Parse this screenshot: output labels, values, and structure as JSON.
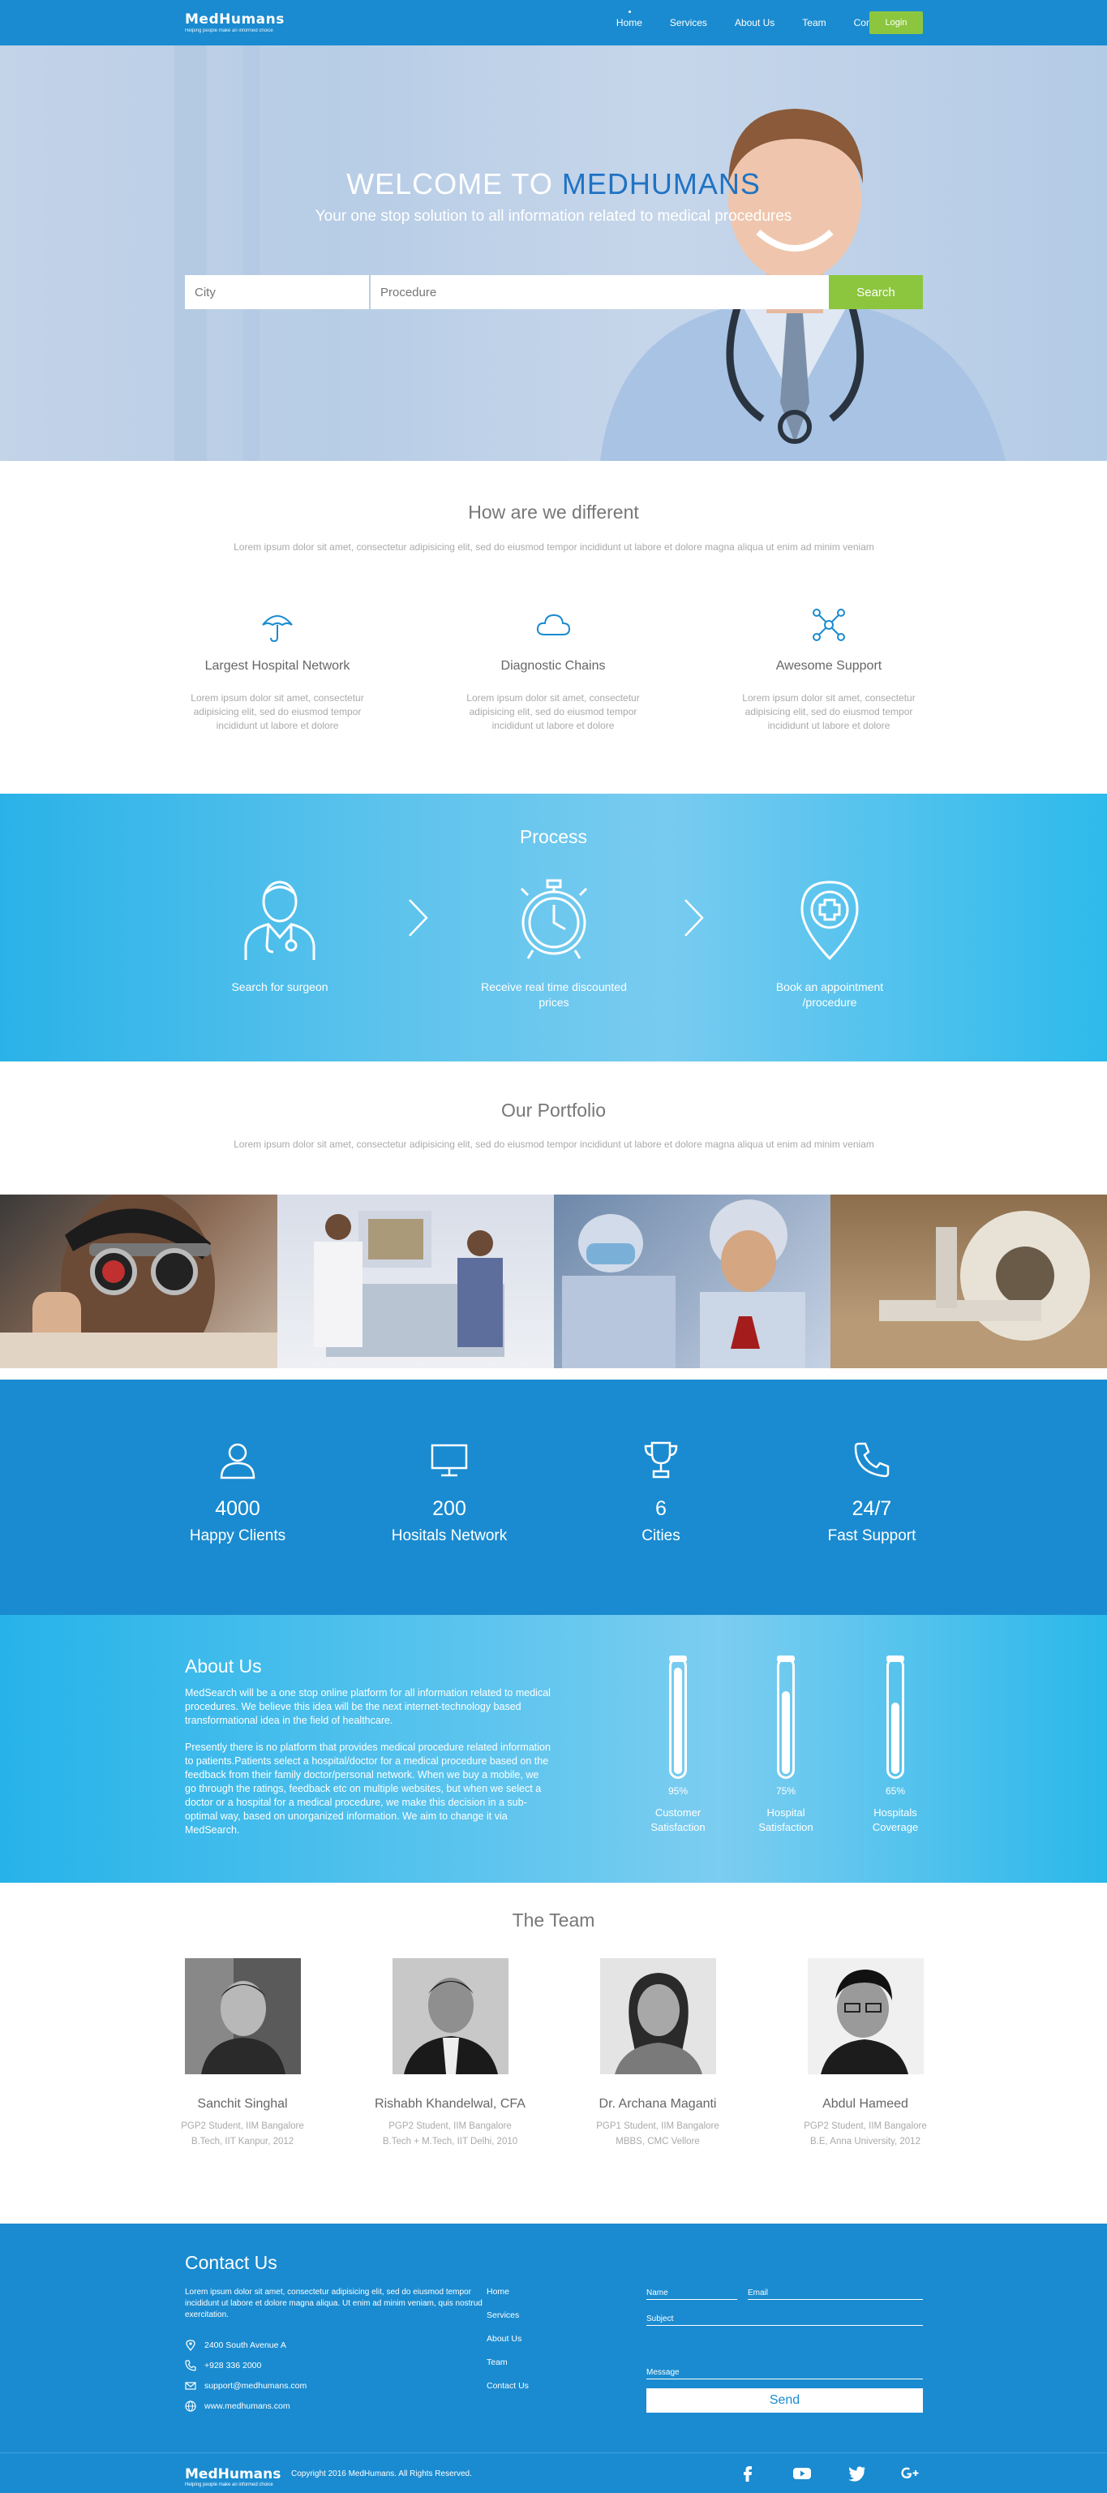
{
  "nav": {
    "logo": "MedHumans",
    "tagline": "Helping people make an informed choice",
    "links": [
      "Home",
      "Services",
      "About Us",
      "Team",
      "Contact Us"
    ],
    "login": "Login"
  },
  "hero": {
    "title_prefix": "WELCOME TO ",
    "title_brand": "MEDHUMANS",
    "subtitle": "Your one stop solution to all information related to medical procedures",
    "city_placeholder": "City",
    "procedure_placeholder": "Procedure",
    "search_button": "Search"
  },
  "different": {
    "title": "How are we different",
    "desc": "Lorem ipsum dolor sit amet, consectetur adipisicing elit, sed do eiusmod tempor incididunt ut labore et dolore magna aliqua ut enim ad minim veniam",
    "features": [
      {
        "icon": "umbrella-icon",
        "title": "Largest Hospital Network",
        "desc": "Lorem ipsum dolor sit amet, consectetur adipisicing elit, sed do eiusmod tempor incididunt ut labore et dolore"
      },
      {
        "icon": "cloud-icon",
        "title": "Diagnostic Chains",
        "desc": "Lorem ipsum dolor sit amet, consectetur adipisicing elit, sed do eiusmod tempor incididunt ut labore et dolore"
      },
      {
        "icon": "network-icon",
        "title": "Awesome Support",
        "desc": "Lorem ipsum dolor sit amet, consectetur adipisicing elit, sed do eiusmod tempor incididunt ut labore et dolore"
      }
    ]
  },
  "process": {
    "title": "Process",
    "steps": [
      {
        "icon": "doctor-icon",
        "label": "Search for surgeon"
      },
      {
        "icon": "alarm-clock-icon",
        "label": "Receive real time discounted prices"
      },
      {
        "icon": "medical-pin-icon",
        "label": "Book an appointment /procedure"
      }
    ]
  },
  "portfolio": {
    "title": "Our Portfolio",
    "desc": "Lorem ipsum dolor sit amet, consectetur adipisicing elit, sed do eiusmod tempor incididunt ut labore et dolore magna aliqua ut enim ad minim veniam"
  },
  "stats": [
    {
      "icon": "user-icon",
      "value": "4000",
      "label": "Happy Clients"
    },
    {
      "icon": "monitor-icon",
      "value": "200",
      "label": "Hositals Network"
    },
    {
      "icon": "trophy-icon",
      "value": "6",
      "label": "Cities"
    },
    {
      "icon": "phone-icon",
      "value": "24/7",
      "label": "Fast Support"
    }
  ],
  "about": {
    "title": "About Us",
    "para1": "MedSearch will be a one stop online platform for all information related to medical procedures. We believe this idea will be the next internet-technology based transformational idea in the field of healthcare.",
    "para2": "Presently there is no platform that provides medical procedure related information to patients.Patients select a hospital/doctor for a medical procedure based on the feedback from their family doctor/personal network. When we buy a mobile, we go through the ratings, feedback etc on multiple websites, but when we select a doctor or a hospital for a medical procedure, we make this decision in a sub-optimal way, based on unorganized information. We aim to change it via MedSearch.",
    "meters": [
      {
        "percent_label": "95%",
        "value": 0.95,
        "label": "Customer Satisfaction"
      },
      {
        "percent_label": "75%",
        "value": 0.75,
        "label": "Hospital Satisfaction"
      },
      {
        "percent_label": "65%",
        "value": 0.65,
        "label": "Hospitals Coverage"
      }
    ]
  },
  "team": {
    "title": "The Team",
    "members": [
      {
        "name": "Sanchit Singhal",
        "role": "PGP2 Student, IIM Bangalore",
        "edu": "B.Tech, IIT Kanpur, 2012"
      },
      {
        "name": "Rishabh Khandelwal, CFA",
        "role": "PGP2 Student, IIM Bangalore",
        "edu": "B.Tech + M.Tech, IIT Delhi, 2010"
      },
      {
        "name": "Dr. Archana Maganti",
        "role": "PGP1 Student, IIM Bangalore",
        "edu": "MBBS, CMC Vellore"
      },
      {
        "name": "Abdul Hameed",
        "role": "PGP2 Student, IIM Bangalore",
        "edu": "B.E, Anna University, 2012"
      }
    ]
  },
  "contact": {
    "title": "Contact Us",
    "desc": "Lorem ipsum dolor sit amet, consectetur adipisicing elit, sed do eiusmod tempor incididunt ut labore et dolore magna aliqua. Ut enim ad minim veniam, quis nostrud exercitation.",
    "address": "2400 South Avenue A",
    "phone": "+928 336 2000",
    "email": "support@medhumans.com",
    "website": "www.medhumans.com",
    "links": [
      "Home",
      "Services",
      "About Us",
      "Team",
      "Contact Us"
    ],
    "form": {
      "name": "Name",
      "email": "Email",
      "subject": "Subject",
      "message": "Message",
      "send": "Send"
    }
  },
  "footer": {
    "logo": "MedHumans",
    "tagline": "Helping people make an informed choice",
    "copyright": "Copyright 2016 MedHumans. All Rights Reserved.",
    "social": [
      "facebook-icon",
      "youtube-icon",
      "twitter-icon",
      "google-plus-icon"
    ]
  }
}
